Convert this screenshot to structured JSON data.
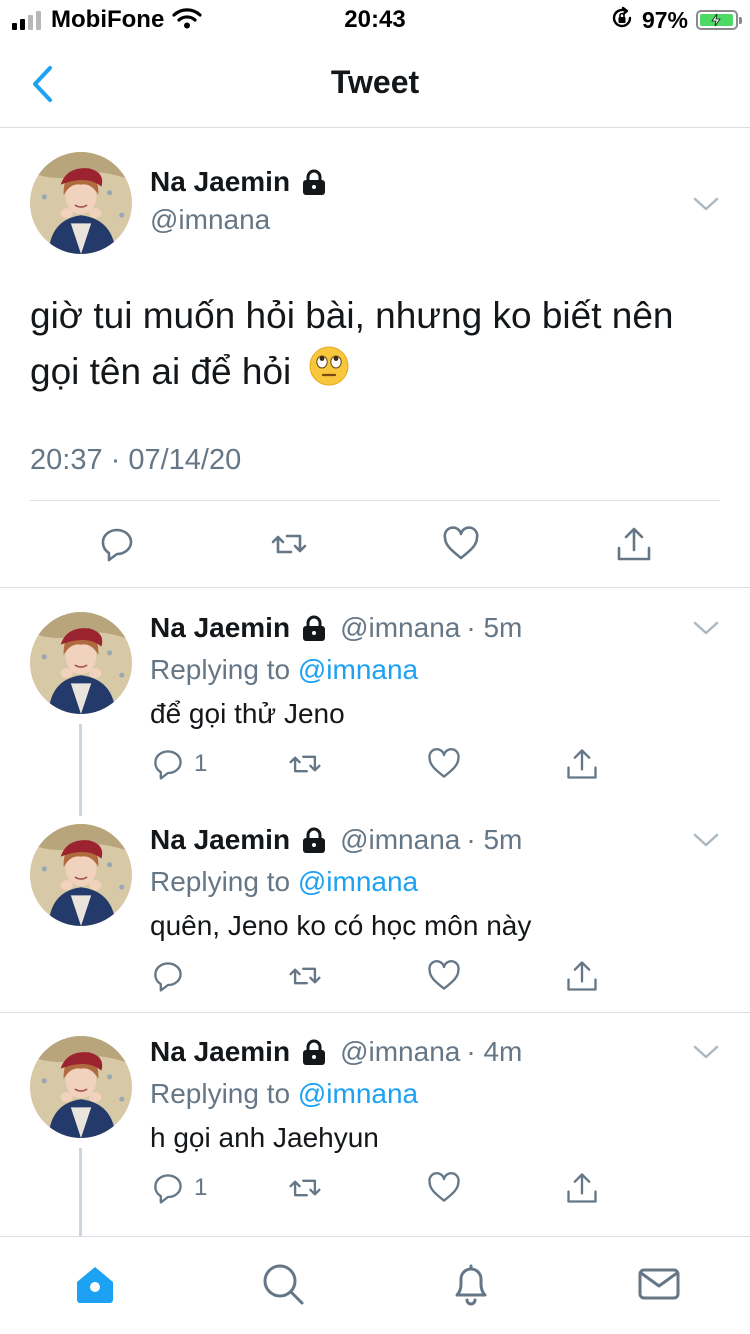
{
  "status_bar": {
    "carrier": "MobiFone",
    "time": "20:43",
    "battery_percent": "97%",
    "battery_level": 0.97,
    "signal_bars": 2
  },
  "nav": {
    "title": "Tweet",
    "back_icon": "chevron-left-icon"
  },
  "colors": {
    "accent": "#1da1f2",
    "text_primary": "#14171a",
    "text_secondary": "#657786",
    "divider": "#d8dee3",
    "battery_green": "#4cd964"
  },
  "main_tweet": {
    "author": {
      "name": "Na Jaemin",
      "handle": "@imnana",
      "protected_icon": "lock-icon"
    },
    "text": "giờ tui muốn hỏi bài, nhưng ko biết nên gọi tên ai để hỏi",
    "emoji": "face-with-rolling-eyes",
    "timestamp": "20:37 · 07/14/20",
    "actions": [
      "reply-icon",
      "retweet-icon",
      "like-icon",
      "share-icon"
    ]
  },
  "replies": [
    {
      "name": "Na Jaemin",
      "handle": "@imnana",
      "time": "· 5m",
      "replying_label": "Replying to",
      "replying_to": "@imnana",
      "text": "để gọi thử Jeno",
      "reply_count": "1"
    },
    {
      "name": "Na Jaemin",
      "handle": "@imnana",
      "time": "· 5m",
      "replying_label": "Replying to",
      "replying_to": "@imnana",
      "text": "quên, Jeno ko có học môn này",
      "reply_count": ""
    },
    {
      "name": "Na Jaemin",
      "handle": "@imnana",
      "time": "· 4m",
      "replying_label": "Replying to",
      "replying_to": "@imnana",
      "text": "h gọi anh Jaehyun",
      "reply_count": "1"
    }
  ],
  "tab_bar": {
    "tabs": [
      "home-icon",
      "search-icon",
      "notifications-icon",
      "messages-icon"
    ],
    "active": "home-icon"
  }
}
